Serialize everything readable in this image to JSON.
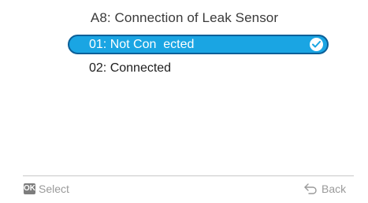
{
  "screen": {
    "title": "A8: Connection of Leak Sensor"
  },
  "options": [
    {
      "label": "01: Not Con  ected",
      "selected": true,
      "icon": "check-circle-icon"
    },
    {
      "label": "02: Connected",
      "selected": false
    }
  ],
  "footer": {
    "ok_key": "OK",
    "select_label": "Select",
    "back_icon": "return-arrow-icon",
    "back_label": "Back"
  },
  "colors": {
    "selection_fill": "#1aa5e3",
    "selection_border": "#0b5f98",
    "footer_text": "#9a9a9a",
    "ok_badge": "#7d7d7d"
  }
}
